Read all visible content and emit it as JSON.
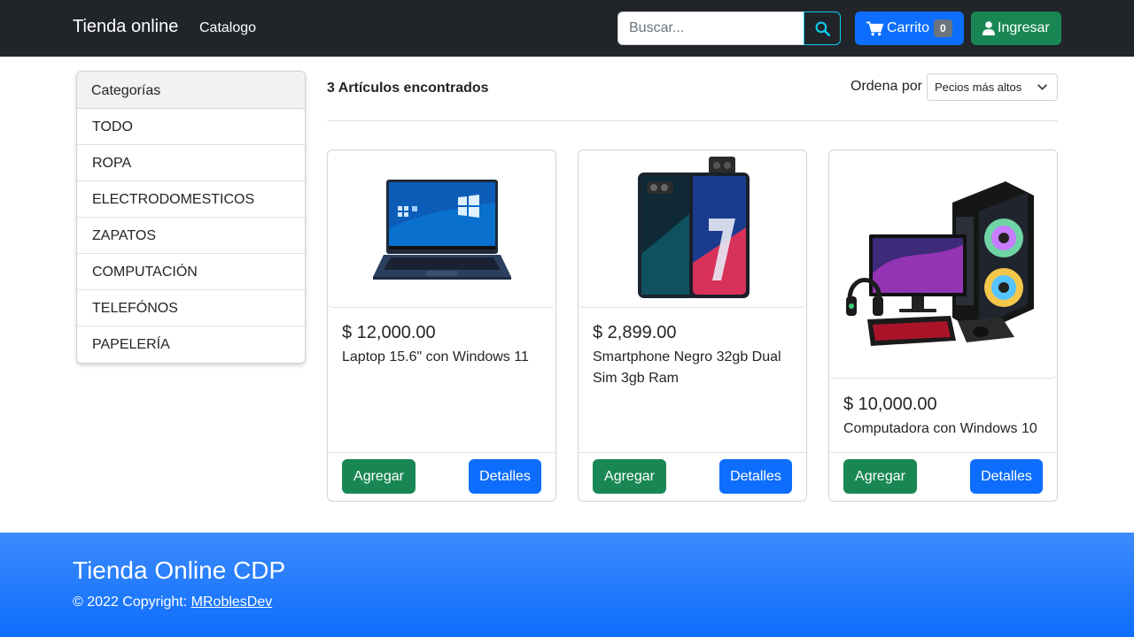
{
  "navbar": {
    "brand": "Tienda online",
    "link": "Catalogo",
    "search_placeholder": "Buscar...",
    "search_icon": "search-icon",
    "cart_label": "Carrito",
    "cart_count": "0",
    "cart_icon": "cart-icon",
    "login_label": "Ingresar",
    "login_icon": "user-icon",
    "colors": {
      "background": "#212529",
      "primary": "#0d6efd",
      "success": "#198754",
      "info": "#0dcaf0"
    }
  },
  "sidebar": {
    "header": "Categorías",
    "items": [
      "TODO",
      "ROPA",
      "ELECTRODOMESTICOS",
      "ZAPATOS",
      "COMPUTACIÓN",
      "TELEFÓNOS",
      "PAPELERÍA"
    ]
  },
  "main": {
    "results": "3 Artículos encontrados",
    "sort_label": "Ordena por",
    "sort_value": "Pecios más altos"
  },
  "products": [
    {
      "price": "$ 12,000.00",
      "title": "Laptop 15.6\" con Windows 11",
      "image": "laptop-image",
      "add_label": "Agregar",
      "details_label": "Detalles"
    },
    {
      "price": "$ 2,899.00",
      "title": "Smartphone Negro 32gb Dual Sim 3gb Ram",
      "image": "smartphone-image",
      "add_label": "Agregar",
      "details_label": "Detalles"
    },
    {
      "price": "$ 10,000.00",
      "title": "Computadora con Windows 10",
      "image": "desktop-computer-image",
      "add_label": "Agregar",
      "details_label": "Detalles"
    }
  ],
  "footer": {
    "title": "Tienda Online CDP",
    "copyright": "© 2022 Copyright:",
    "author": "MRoblesDev",
    "color": "#0d6efd"
  }
}
